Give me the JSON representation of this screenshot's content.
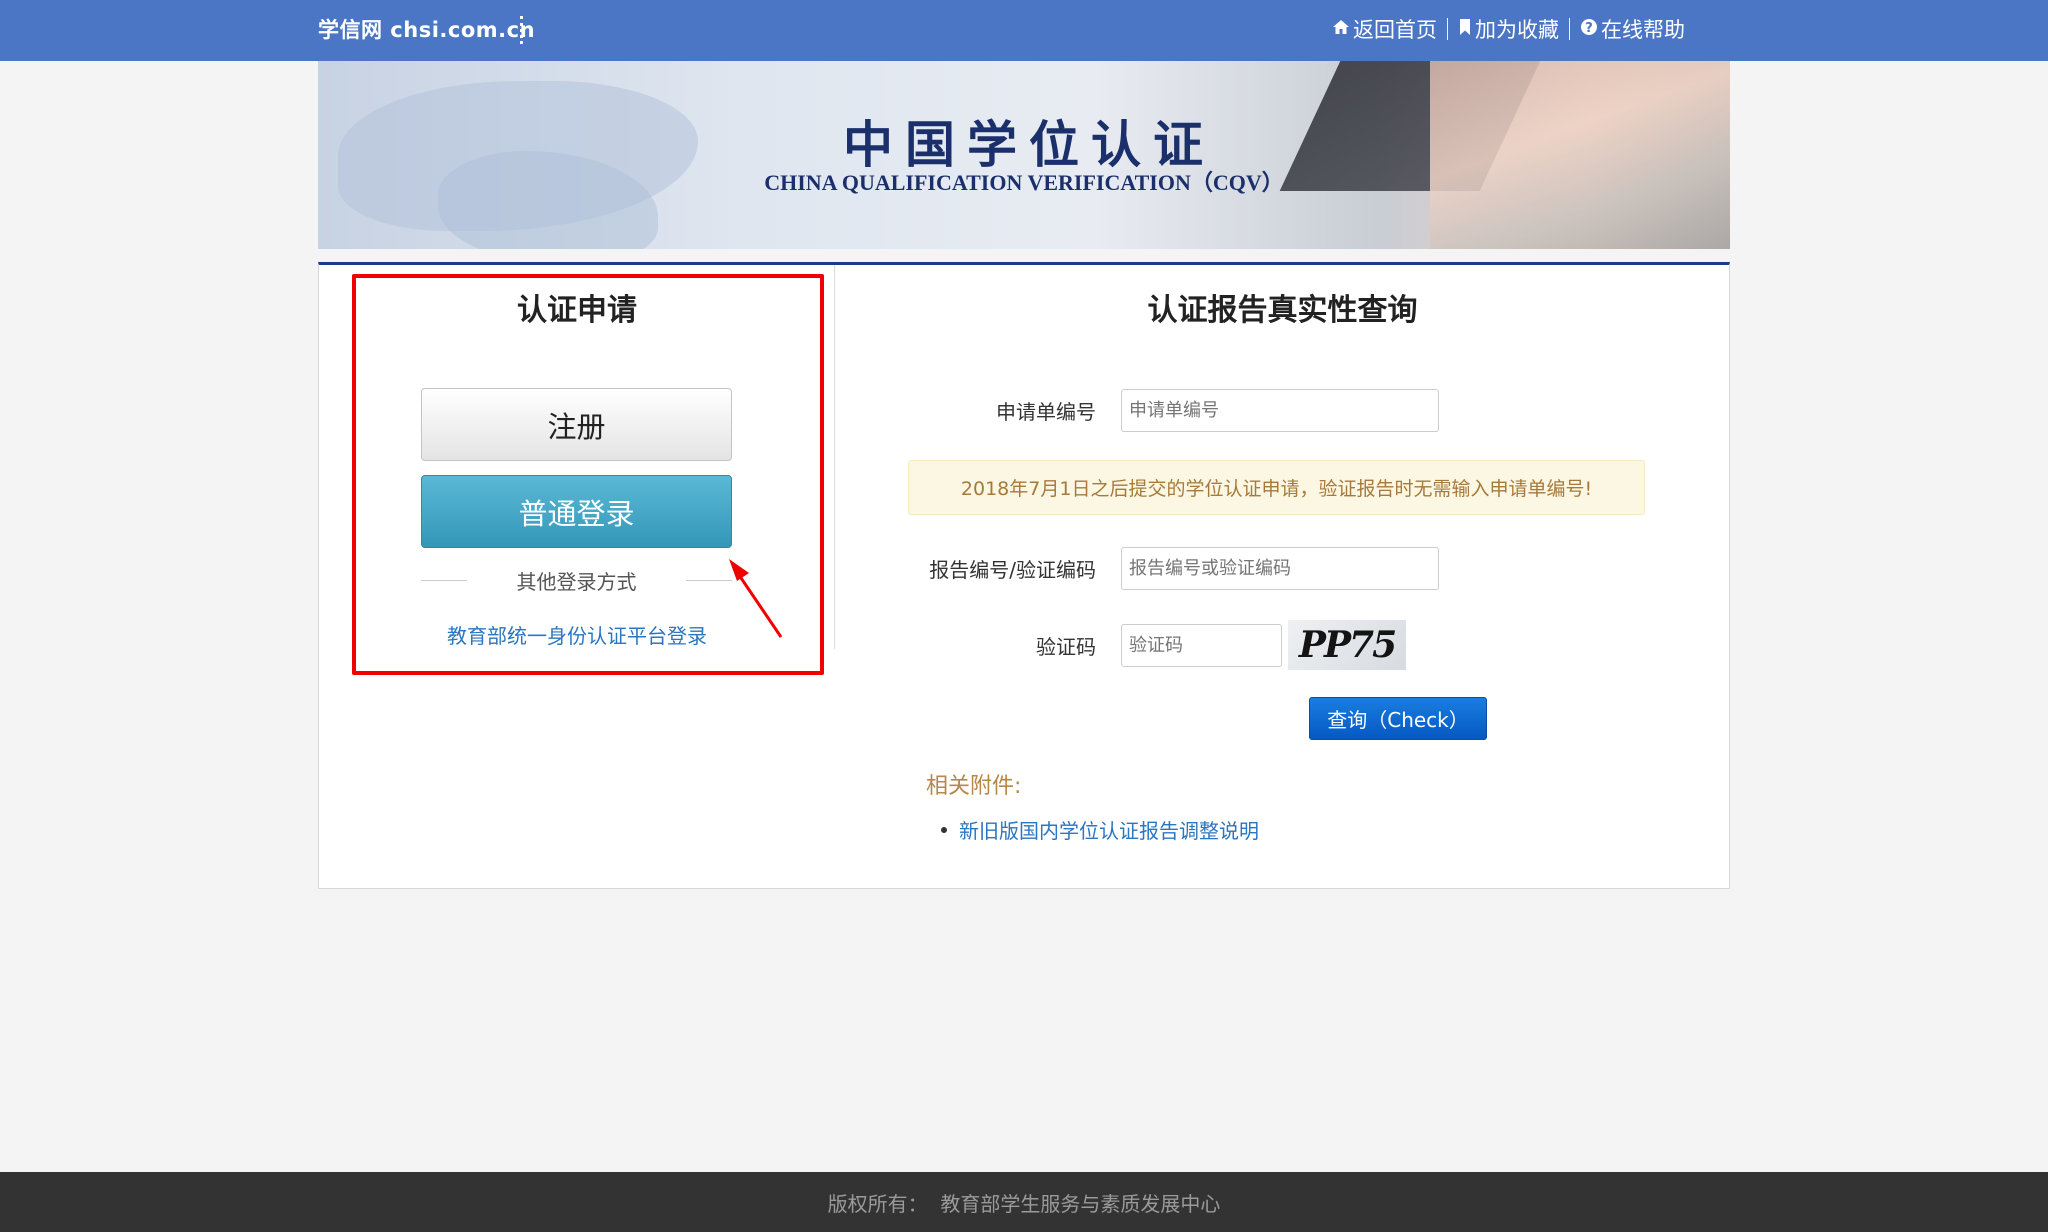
{
  "topbar": {
    "brand": "学信网 chsi.com.cn",
    "nav": [
      {
        "icon": "home-icon",
        "label": "返回首页"
      },
      {
        "icon": "bookmark-icon",
        "label": "加为收藏"
      },
      {
        "icon": "help-icon",
        "label": "在线帮助"
      }
    ]
  },
  "banner": {
    "title_cn": "中国学位认证",
    "title_en": "CHINA QUALIFICATION VERIFICATION（CQV）"
  },
  "apply": {
    "title": "认证申请",
    "register_label": "注册",
    "login_label": "普通登录",
    "other_login_label": "其他登录方式",
    "moe_login_link": "教育部统一身份认证平台登录"
  },
  "query": {
    "title": "认证报告真实性查询",
    "application_no": {
      "label": "申请单编号",
      "placeholder": "申请单编号",
      "value": ""
    },
    "notice": "2018年7月1日之后提交的学位认证申请，验证报告时无需输入申请单编号!",
    "report_no": {
      "label": "报告编号/验证编码",
      "placeholder": "报告编号或验证编码",
      "value": ""
    },
    "captcha": {
      "label": "验证码",
      "placeholder": "验证码",
      "value": "",
      "image_text": "PP75"
    },
    "check_button": "查询（Check）",
    "attachments_title": "相关附件:",
    "attachments": [
      "新旧版国内学位认证报告调整说明"
    ]
  },
  "footer": {
    "copyright": "版权所有：  教育部学生服务与素质发展中心"
  },
  "colors": {
    "topbar": "#4a76c5",
    "highlight_box": "#f00000",
    "login_button": "#3aa0c2",
    "check_button": "#0a66d0",
    "link": "#2a76c0"
  }
}
